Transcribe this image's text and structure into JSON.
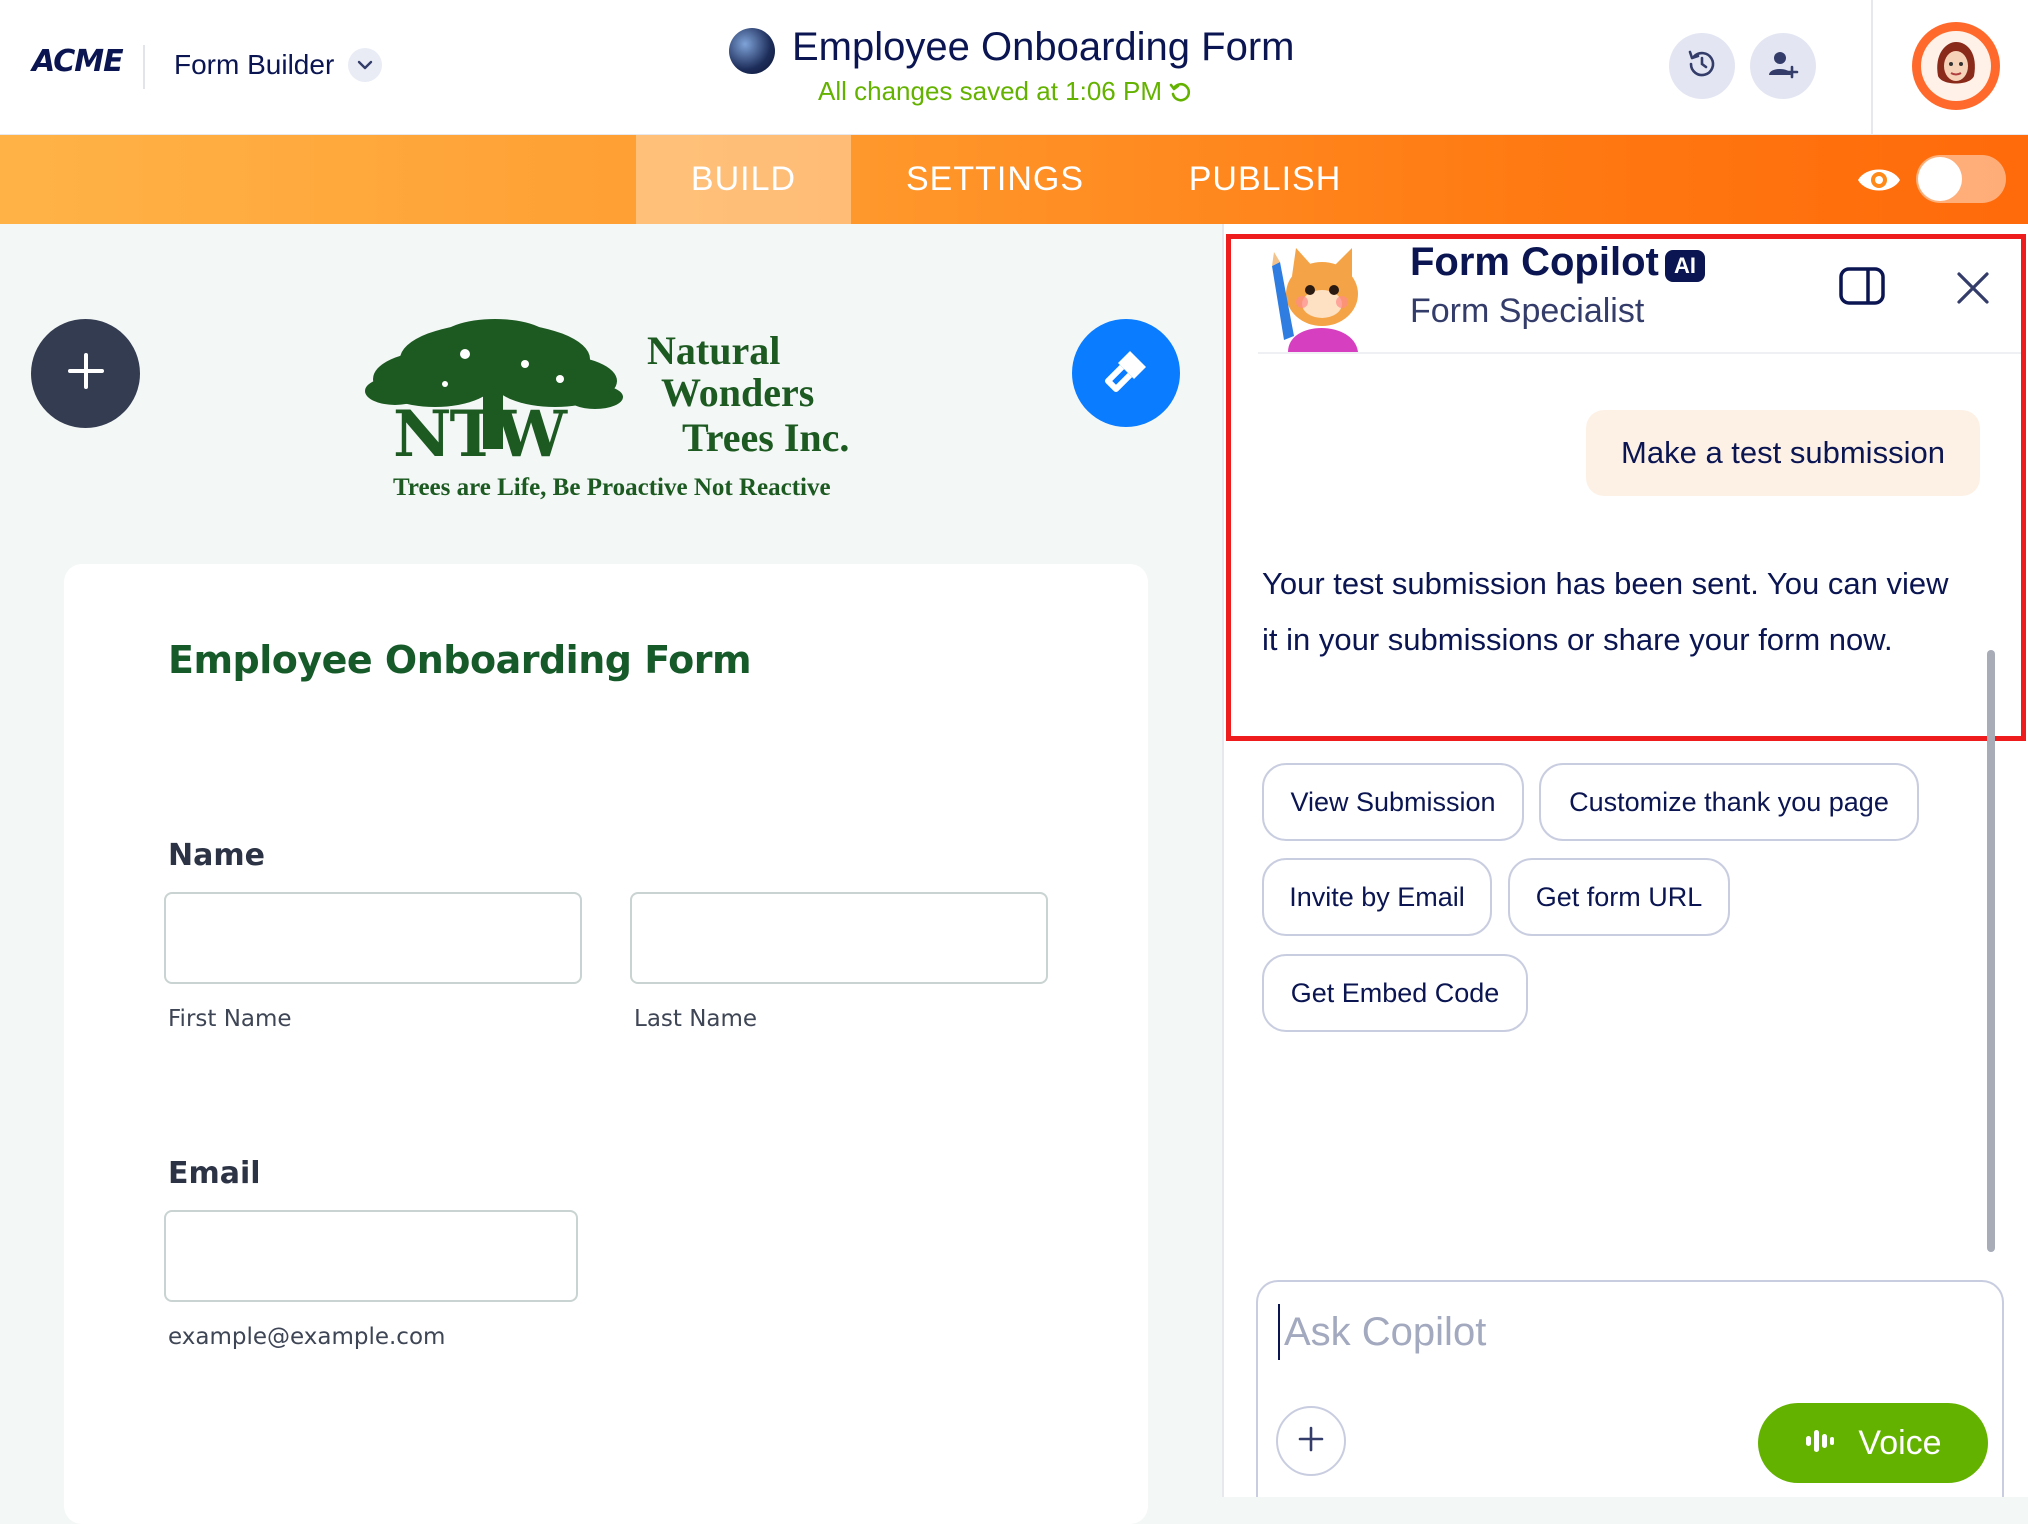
{
  "header": {
    "brand": "ACME",
    "app_name": "Form Builder",
    "form_title": "Employee Onboarding Form",
    "save_status": "All changes saved at 1:06 PM",
    "icons": [
      "history-icon",
      "add-collaborator-icon",
      "user-avatar"
    ]
  },
  "nav": {
    "tabs": [
      {
        "label": "BUILD",
        "active": true
      },
      {
        "label": "SETTINGS",
        "active": false
      },
      {
        "label": "PUBLISH",
        "active": false
      }
    ],
    "preview_toggle_on": false
  },
  "logo": {
    "line1": "Natural",
    "line2": "Wonders",
    "line3": "Trees Inc.",
    "initials": "NTW",
    "tagline": "Trees are Life, Be Proactive Not Reactive"
  },
  "form": {
    "title": "Employee Onboarding Form",
    "name_label": "Name",
    "first_name_sub": "First Name",
    "last_name_sub": "Last Name",
    "email_label": "Email",
    "email_sub": "example@example.com"
  },
  "copilot": {
    "title": "Form Copilot",
    "badge": "AI",
    "subtitle": "Form Specialist",
    "user_message": "Make a test submission",
    "assistant_reply": "Your test submission has been sent. You can view it in your submissions or share your form now.",
    "suggestions": [
      "View Submission",
      "Customize thank you page",
      "Invite by Email",
      "Get form URL",
      "Get Embed Code"
    ],
    "input_placeholder": "Ask Copilot",
    "voice_label": "Voice"
  },
  "colors": {
    "navy": "#0a1551",
    "orange_start": "#ffb347",
    "orange_end": "#ff6a0a",
    "green_title": "#165a2a",
    "voice_green": "#64b200",
    "highlight_red": "#ee1c1c",
    "primary_blue": "#0a7cff"
  }
}
